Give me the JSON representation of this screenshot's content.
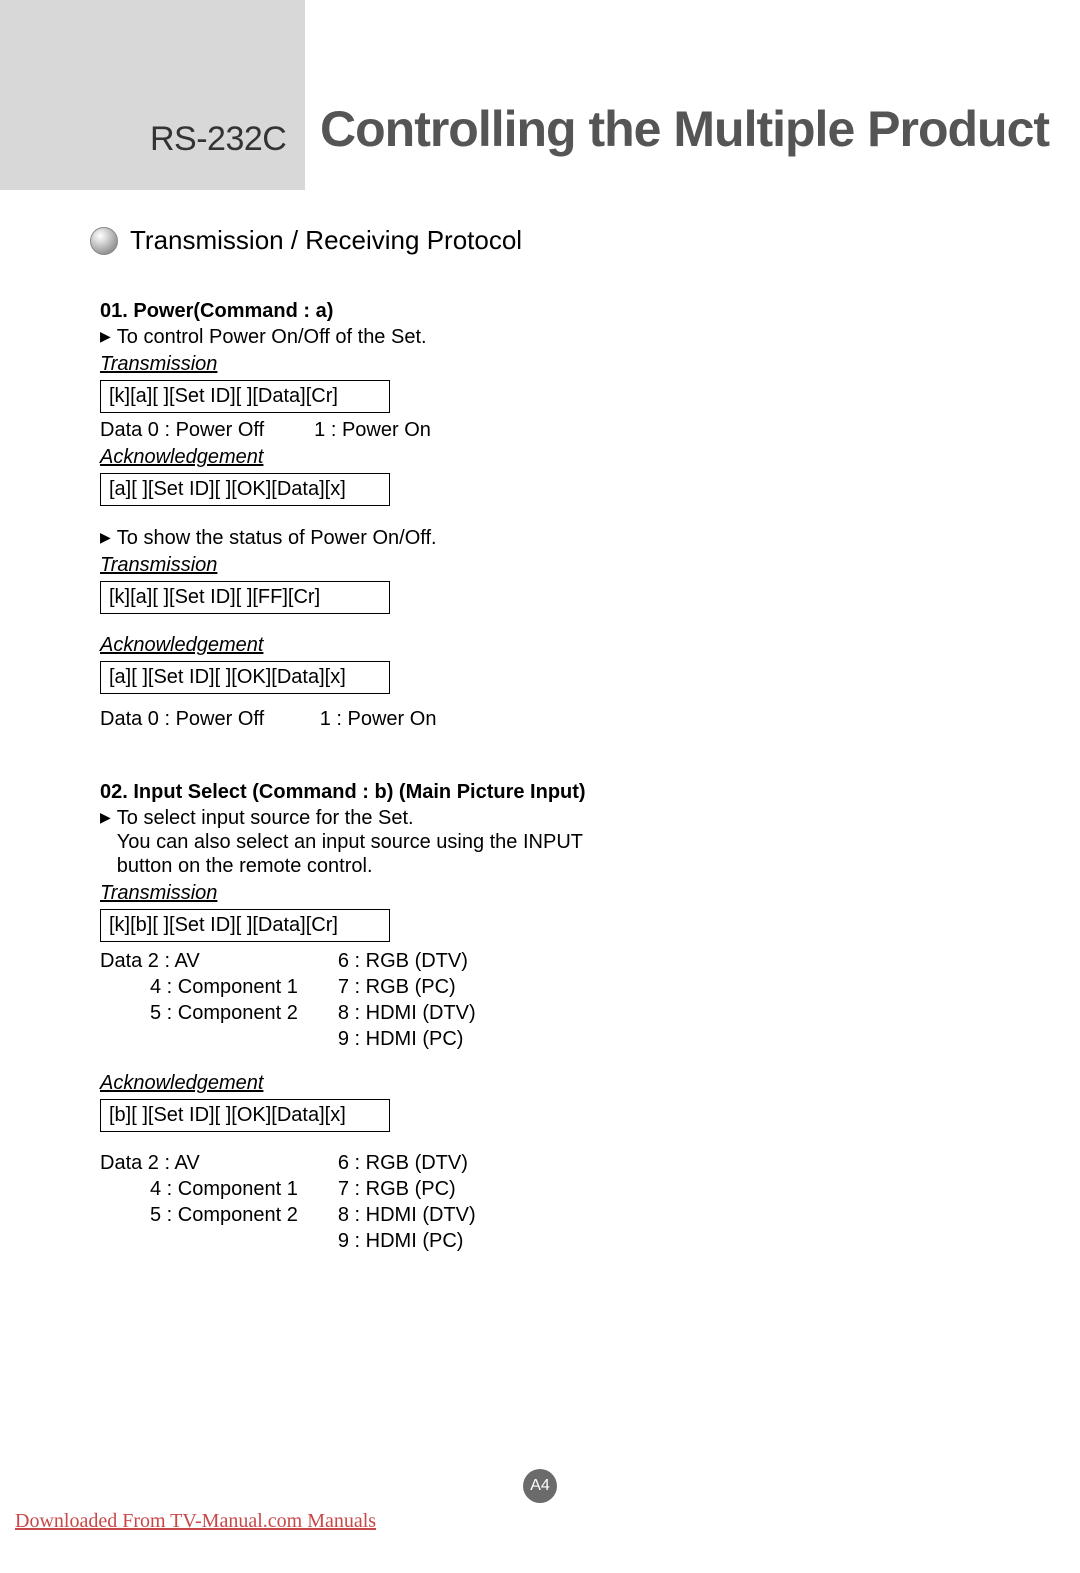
{
  "header": {
    "label": "RS-232C",
    "title": "Controlling the Multiple Product"
  },
  "section_title": "Transmission / Receiving Protocol",
  "cmd01": {
    "title": "01. Power(Command : a)",
    "desc1": "To control Power On/Off of the Set.",
    "trans_label": "Transmission",
    "trans_code1": "[k][a][ ][Set ID][ ][Data][Cr]",
    "data_line1": "Data 0 : Power Off         1 : Power On",
    "ack_label": "Acknowledgement",
    "ack_code1": "[a][ ][Set ID][ ][OK][Data][x]",
    "desc2": "To show the status of Power On/Off.",
    "trans_code2": "[k][a][ ][Set ID][ ][FF][Cr]",
    "ack_code2": "[a][ ][Set ID][ ][OK][Data][x]",
    "data_line2": "Data 0 : Power Off          1 : Power On"
  },
  "cmd02": {
    "title": "02. Input Select (Command : b) (Main Picture Input)",
    "desc1": "To select input source for the Set.",
    "desc2": "You can also select an input source using the INPUT",
    "desc3": "button on the remote control.",
    "trans_label": "Transmission",
    "trans_code": "[k][b][ ][Set ID][ ][Data][Cr]",
    "data_col1_line1": "Data  2 : AV",
    "data_col1_line2": "4 : Component 1",
    "data_col1_line3": "5 : Component 2",
    "data_col2_line1": "6 : RGB (DTV)",
    "data_col2_line2": "7 : RGB (PC)",
    "data_col2_line3": "8 : HDMI (DTV)",
    "data_col2_line4": "9 : HDMI (PC)",
    "ack_label": "Acknowledgement",
    "ack_code": "[b][ ][Set ID][ ][OK][Data][x]"
  },
  "page_number": "A4",
  "footer_link": "Downloaded From TV-Manual.com Manuals"
}
